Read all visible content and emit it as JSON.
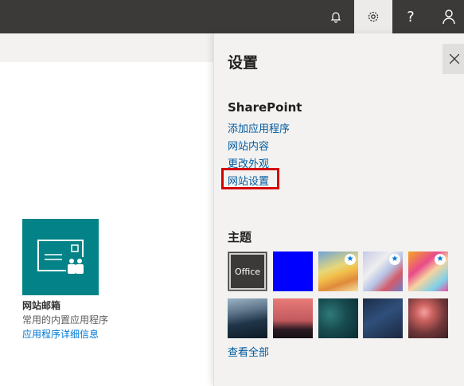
{
  "topbar": {
    "notifications_icon": "bell-icon",
    "settings_icon": "gear-icon",
    "help_label": "?",
    "account_icon": "person-icon"
  },
  "app": {
    "name": "网站邮箱",
    "description": "常用的内置应用程序",
    "details_link": "应用程序详细信息"
  },
  "settings_panel": {
    "title": "设置",
    "sharepoint_heading": "SharePoint",
    "links": [
      "添加应用程序",
      "网站内容",
      "更改外观",
      "网站设置"
    ],
    "highlighted_link": "网站设置",
    "theme_heading": "主题",
    "themes": [
      {
        "label": "Office",
        "selected": true
      },
      {
        "color": "#0000ff"
      },
      {
        "favorite": true
      },
      {
        "favorite": true
      },
      {
        "favorite": true
      },
      {},
      {},
      {},
      {},
      {}
    ],
    "see_all": "查看全部"
  },
  "colors": {
    "topbar": "#3b3a39",
    "panel": "#f3f2f1",
    "link": "#005a9e",
    "app_tile": "#038387",
    "highlight_border": "#d40000"
  }
}
